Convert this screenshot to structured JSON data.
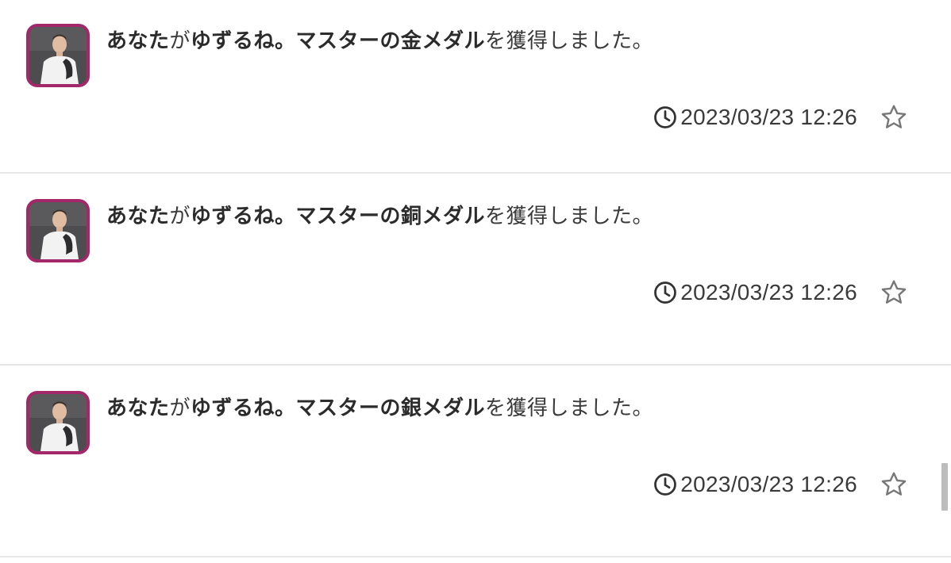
{
  "notifications": [
    {
      "user": "あなた",
      "connector": "が",
      "medal_name": "ゆずるね。マスターの金メダル",
      "suffix": "を獲得しました。",
      "timestamp": "2023/03/23 12:26"
    },
    {
      "user": "あなた",
      "connector": "が",
      "medal_name": "ゆずるね。マスターの銅メダル",
      "suffix": "を獲得しました。",
      "timestamp": "2023/03/23 12:26"
    },
    {
      "user": "あなた",
      "connector": "が",
      "medal_name": "ゆずるね。マスターの銀メダル",
      "suffix": "を獲得しました。",
      "timestamp": "2023/03/23 12:26"
    }
  ],
  "colors": {
    "avatar_border": "#a3286a",
    "divider": "#e6e6e6",
    "icon_gray": "#777777"
  },
  "icons": {
    "time": "clock-icon",
    "favorite": "star-outline-icon"
  }
}
